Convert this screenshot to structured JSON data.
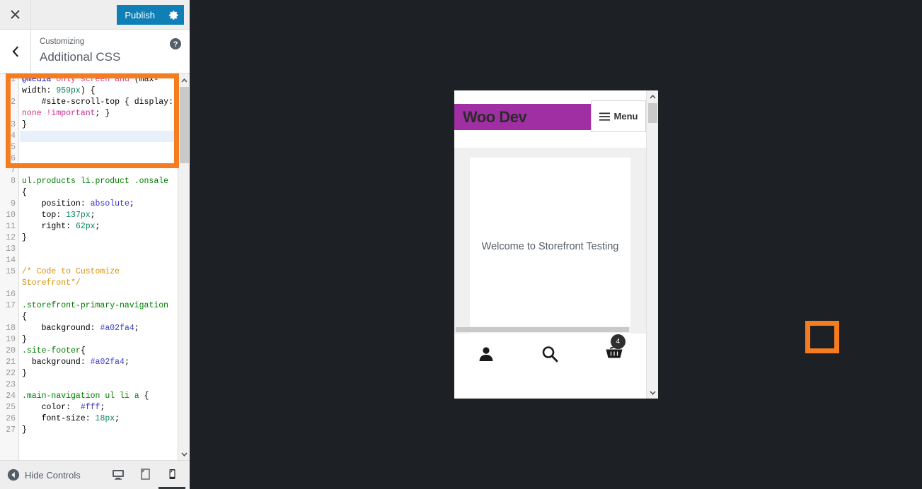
{
  "customizer": {
    "close_label": "Close",
    "publish_label": "Publish",
    "gear_label": "settings-gear",
    "back_label": "Back",
    "help_label": "Help",
    "breadcrumb": "Customizing",
    "panel_title": "Additional CSS",
    "hide_controls_label": "Hide Controls",
    "devices": [
      {
        "name": "desktop",
        "label": "Enter desktop preview mode",
        "active": false
      },
      {
        "name": "tablet",
        "label": "Enter tablet preview mode",
        "active": false
      },
      {
        "name": "mobile",
        "label": "Enter mobile preview mode",
        "active": true
      }
    ],
    "accent_blue": "#0f7fb5",
    "annotation_color": "#f57c1f"
  },
  "editor": {
    "active_line": 4,
    "lines": [
      {
        "n": 1,
        "tokens": [
          {
            "t": "@media",
            "c": "t-atrule"
          },
          {
            "t": " ",
            "c": "t-punct"
          },
          {
            "t": "only screen and",
            "c": "t-keyword"
          },
          {
            "t": " (",
            "c": "t-punct"
          },
          {
            "t": "max-width",
            "c": "t-prop"
          },
          {
            "t": ": ",
            "c": "t-punct"
          },
          {
            "t": "959px",
            "c": "t-num"
          },
          {
            "t": ") {",
            "c": "t-punct"
          }
        ]
      },
      {
        "n": 2,
        "tokens": [
          {
            "t": "    ",
            "c": "t-punct"
          },
          {
            "t": "#site-scroll-top",
            "c": "t-prop"
          },
          {
            "t": " { ",
            "c": "t-punct"
          },
          {
            "t": "display",
            "c": "t-prop"
          },
          {
            "t": ": ",
            "c": "t-punct"
          },
          {
            "t": "none",
            "c": "t-keyword"
          },
          {
            "t": " ",
            "c": "t-punct"
          },
          {
            "t": "!important",
            "c": "t-imp"
          },
          {
            "t": "; }",
            "c": "t-punct"
          }
        ]
      },
      {
        "n": 3,
        "tokens": [
          {
            "t": "}",
            "c": "t-punct"
          }
        ]
      },
      {
        "n": 4,
        "tokens": [
          {
            "t": "",
            "c": "t-punct"
          }
        ]
      },
      {
        "n": 5,
        "tokens": [
          {
            "t": "",
            "c": "t-punct"
          }
        ]
      },
      {
        "n": 6,
        "tokens": [
          {
            "t": "",
            "c": "t-punct"
          }
        ]
      },
      {
        "n": 7,
        "tokens": [
          {
            "t": "",
            "c": "t-punct"
          }
        ]
      },
      {
        "n": 8,
        "tokens": [
          {
            "t": "ul.products li.product .onsale",
            "c": "t-selector"
          },
          {
            "t": " {",
            "c": "t-punct"
          }
        ]
      },
      {
        "n": 9,
        "tokens": [
          {
            "t": "    ",
            "c": "t-punct"
          },
          {
            "t": "position",
            "c": "t-prop"
          },
          {
            "t": ": ",
            "c": "t-punct"
          },
          {
            "t": "absolute",
            "c": "t-value"
          },
          {
            "t": ";",
            "c": "t-punct"
          }
        ]
      },
      {
        "n": 10,
        "tokens": [
          {
            "t": "    ",
            "c": "t-punct"
          },
          {
            "t": "top",
            "c": "t-prop"
          },
          {
            "t": ": ",
            "c": "t-punct"
          },
          {
            "t": "137px",
            "c": "t-num"
          },
          {
            "t": ";",
            "c": "t-punct"
          }
        ]
      },
      {
        "n": 11,
        "tokens": [
          {
            "t": "    ",
            "c": "t-punct"
          },
          {
            "t": "right",
            "c": "t-prop"
          },
          {
            "t": ": ",
            "c": "t-punct"
          },
          {
            "t": "62px",
            "c": "t-num"
          },
          {
            "t": ";",
            "c": "t-punct"
          }
        ]
      },
      {
        "n": 12,
        "tokens": [
          {
            "t": "}",
            "c": "t-punct"
          }
        ]
      },
      {
        "n": 13,
        "tokens": [
          {
            "t": "",
            "c": "t-punct"
          }
        ]
      },
      {
        "n": 14,
        "tokens": [
          {
            "t": "",
            "c": "t-punct"
          }
        ]
      },
      {
        "n": 15,
        "tokens": [
          {
            "t": "/* Code to Customize Storefront*/",
            "c": "t-comment"
          }
        ]
      },
      {
        "n": 16,
        "tokens": [
          {
            "t": "",
            "c": "t-punct"
          }
        ]
      },
      {
        "n": 17,
        "tokens": [
          {
            "t": ".storefront-primary-navigation",
            "c": "t-selector"
          },
          {
            "t": " {",
            "c": "t-punct"
          }
        ]
      },
      {
        "n": 18,
        "tokens": [
          {
            "t": "    ",
            "c": "t-punct"
          },
          {
            "t": "background",
            "c": "t-prop"
          },
          {
            "t": ": ",
            "c": "t-punct"
          },
          {
            "t": "#a02fa4",
            "c": "t-hex"
          },
          {
            "t": ";",
            "c": "t-punct"
          }
        ]
      },
      {
        "n": 19,
        "tokens": [
          {
            "t": "}",
            "c": "t-punct"
          }
        ]
      },
      {
        "n": 20,
        "tokens": [
          {
            "t": ".site-footer",
            "c": "t-selector"
          },
          {
            "t": "{",
            "c": "t-punct"
          }
        ]
      },
      {
        "n": 21,
        "tokens": [
          {
            "t": "  ",
            "c": "t-punct"
          },
          {
            "t": "background",
            "c": "t-prop"
          },
          {
            "t": ": ",
            "c": "t-punct"
          },
          {
            "t": "#a02fa4",
            "c": "t-hex"
          },
          {
            "t": ";",
            "c": "t-punct"
          }
        ]
      },
      {
        "n": 22,
        "tokens": [
          {
            "t": "}",
            "c": "t-punct"
          }
        ]
      },
      {
        "n": 23,
        "tokens": [
          {
            "t": "",
            "c": "t-punct"
          }
        ]
      },
      {
        "n": 24,
        "tokens": [
          {
            "t": ".main-navigation ul li a",
            "c": "t-selector"
          },
          {
            "t": " {",
            "c": "t-punct"
          }
        ]
      },
      {
        "n": 25,
        "tokens": [
          {
            "t": "    ",
            "c": "t-punct"
          },
          {
            "t": "color",
            "c": "t-prop"
          },
          {
            "t": ":  ",
            "c": "t-punct"
          },
          {
            "t": "#fff",
            "c": "t-hex"
          },
          {
            "t": ";",
            "c": "t-punct"
          }
        ]
      },
      {
        "n": 26,
        "tokens": [
          {
            "t": "    ",
            "c": "t-punct"
          },
          {
            "t": "font-size",
            "c": "t-prop"
          },
          {
            "t": ": ",
            "c": "t-punct"
          },
          {
            "t": "18px",
            "c": "t-num"
          },
          {
            "t": ";",
            "c": "t-punct"
          }
        ]
      },
      {
        "n": 27,
        "tokens": [
          {
            "t": "}",
            "c": "t-punct"
          }
        ]
      }
    ]
  },
  "preview": {
    "site_title": "Woo Dev",
    "menu_label": "Menu",
    "header_bg": "#a02fa4",
    "welcome_text": "Welcome to Storefront Testing",
    "footer_icons": [
      {
        "name": "account-icon",
        "label": "My Account"
      },
      {
        "name": "search-icon",
        "label": "Search"
      },
      {
        "name": "cart-icon",
        "label": "Cart"
      }
    ],
    "cart_count": "4"
  }
}
